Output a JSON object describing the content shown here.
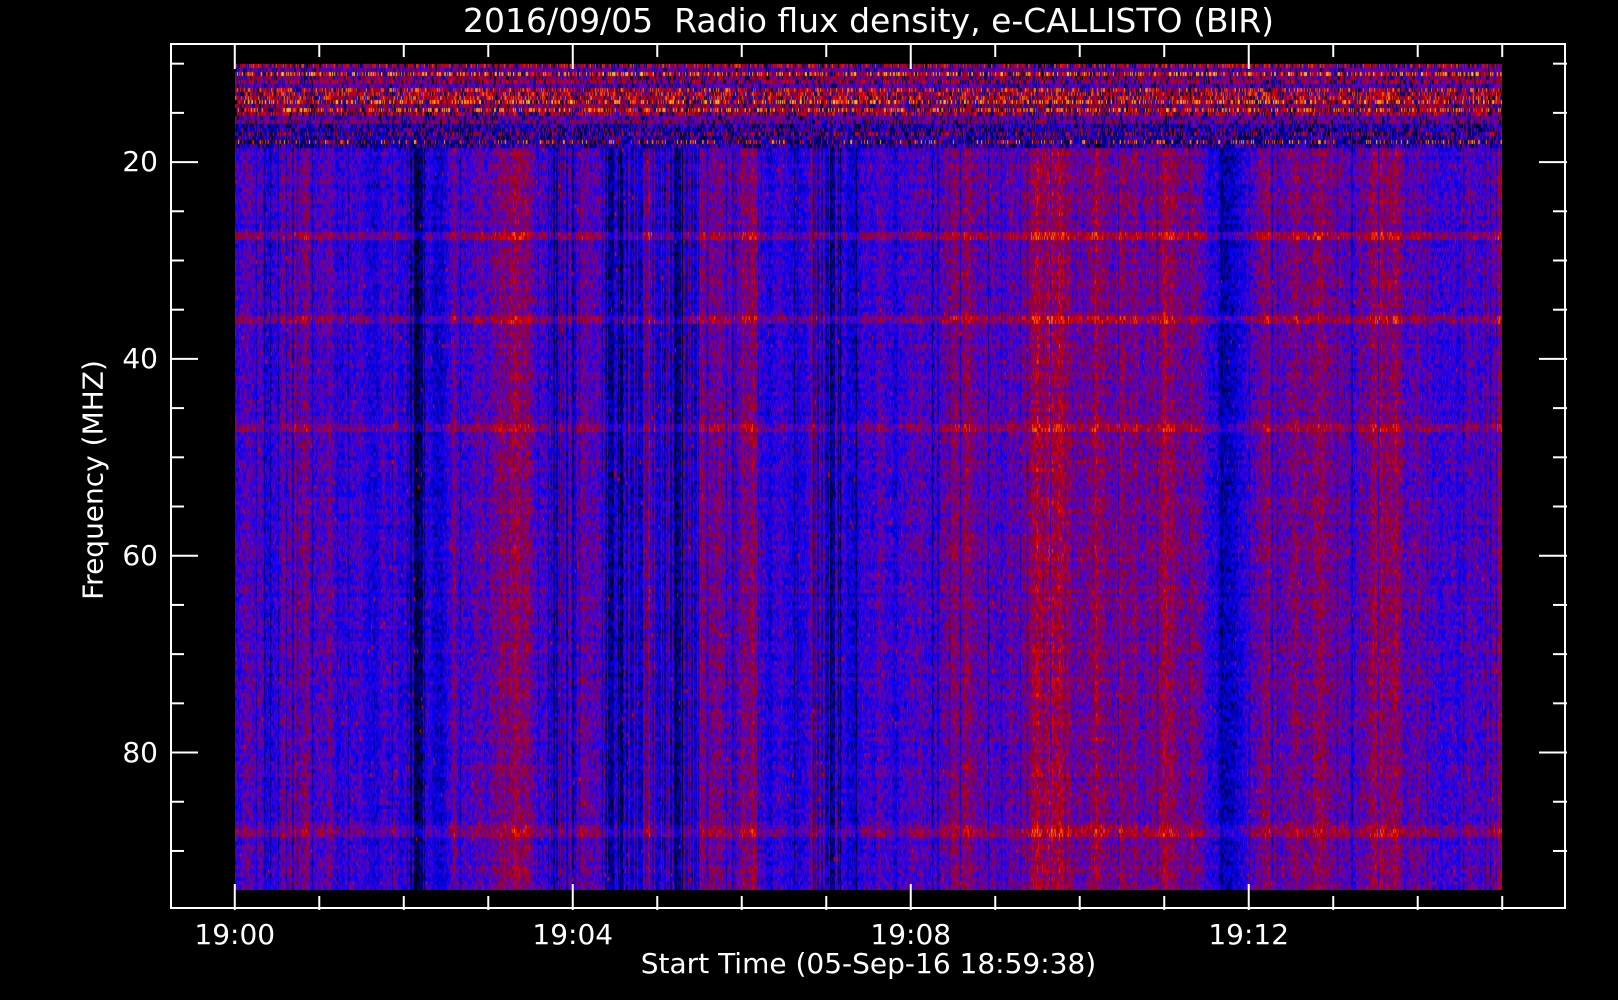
{
  "chart_data": {
    "type": "heatmap",
    "title": "2016/09/05  Radio flux density, e-CALLISTO (BIR)",
    "xlabel": "Start Time (05-Sep-16 18:59:38)",
    "ylabel": "Frequency (MHZ)",
    "x_unit": "seconds after 19:00:00",
    "xlim": [
      -46,
      946
    ],
    "data_xrange": [
      0,
      900
    ],
    "x_major_ticks": [
      {
        "value": 0,
        "label": "19:00"
      },
      {
        "value": 240,
        "label": "19:04"
      },
      {
        "value": 480,
        "label": "19:08"
      },
      {
        "value": 720,
        "label": "19:12"
      }
    ],
    "x_minor_tick_step": 60,
    "ylim": [
      96,
      7.9
    ],
    "data_yrange": [
      10,
      94
    ],
    "y_major_ticks": [
      {
        "value": 20,
        "label": "20"
      },
      {
        "value": 40,
        "label": "40"
      },
      {
        "value": 60,
        "label": "60"
      },
      {
        "value": 80,
        "label": "80"
      }
    ],
    "y_minor_tick_step": 5,
    "y_tick_range": [
      10,
      90
    ],
    "grid": false,
    "legend": "none",
    "colormap": [
      "#000000",
      "#0000ff",
      "#6e00aa",
      "#96001e",
      "#e60000",
      "#ff8c00",
      "#ffff3c"
    ],
    "features": {
      "interference_band_mhz": [
        10,
        18.7
      ],
      "horizontal_lines_mhz": [
        27.5,
        36,
        47,
        88
      ],
      "dark_column_intervals_s": [
        [
          120,
          135
        ],
        [
          222,
          245
        ],
        [
          260,
          330
        ],
        [
          410,
          430
        ]
      ]
    }
  }
}
